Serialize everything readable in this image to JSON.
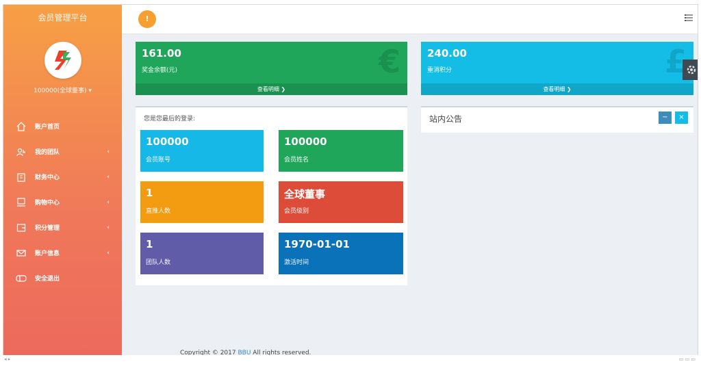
{
  "sidebar": {
    "brand": "会员管理平台",
    "user": "100000(全球董事)",
    "user_chevron": "▾",
    "items": [
      {
        "label": "账户首页",
        "icon": "home-icon",
        "has_children": false
      },
      {
        "label": "我的团队",
        "icon": "team-icon",
        "has_children": true
      },
      {
        "label": "财务中心",
        "icon": "clipboard-icon",
        "has_children": true
      },
      {
        "label": "购物中心",
        "icon": "monitor-icon",
        "has_children": true
      },
      {
        "label": "积分管理",
        "icon": "folder-icon",
        "has_children": true
      },
      {
        "label": "账户信息",
        "icon": "mail-icon",
        "has_children": true
      },
      {
        "label": "安全退出",
        "icon": "logout-icon",
        "has_children": false
      }
    ],
    "chevron": "‹"
  },
  "topbar": {
    "badge": "!"
  },
  "stats": [
    {
      "value": "161.00",
      "label": "奖金余额(元)",
      "footer": "查看明细 ❯",
      "color": "#1fa65a",
      "symbol": "€"
    },
    {
      "value": "240.00",
      "label": "重消积分",
      "footer": "查看明细 ❯",
      "color": "#13bde6",
      "symbol": "£"
    }
  ],
  "info_panel": {
    "note": "您是您最后的登录:",
    "tiles": [
      {
        "value": "100000",
        "label": "会员账号",
        "color": "#16b8e8"
      },
      {
        "value": "100000",
        "label": "会员姓名",
        "color": "#1fa65a"
      },
      {
        "value": "1",
        "label": "直推人数",
        "color": "#f39c12"
      },
      {
        "value": "全球董事",
        "label": "会员级别",
        "color": "#dd4b39"
      },
      {
        "value": "1",
        "label": "团队人数",
        "color": "#605ca8"
      },
      {
        "value": "1970-01-01",
        "label": "激活时间",
        "color": "#0a72b8"
      }
    ]
  },
  "notice_panel": {
    "title": "站内公告",
    "btn_collapse": "−",
    "btn_close": "×"
  },
  "footer": {
    "prefix": "Copyright © 2017",
    "link": "BBU",
    "suffix": "All rights reserved."
  },
  "statusbar": {
    "left": "◂  ▸",
    "right": "▭  ▭  ▭"
  }
}
